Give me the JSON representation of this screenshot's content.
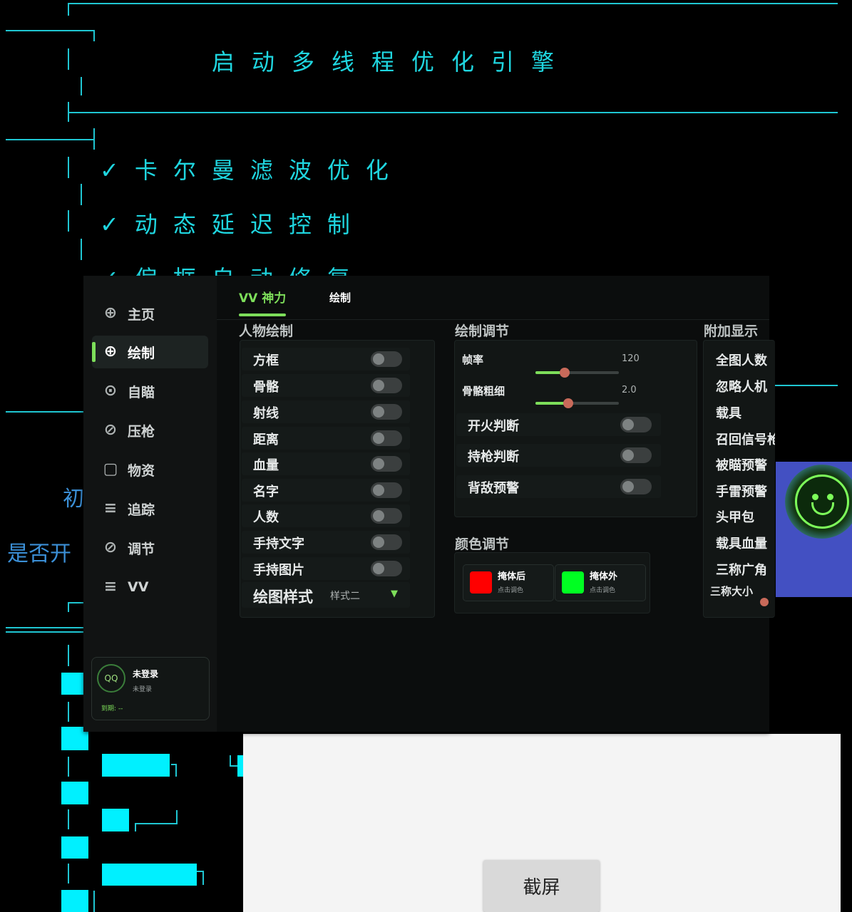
{
  "background": {
    "title": "启动多线程优化引擎",
    "checks": [
      "✓卡尔曼滤波优化",
      "✓动态延迟控制",
      "✓偏框自动修复"
    ],
    "side_text_1": "初",
    "side_text_2": "是否开"
  },
  "colors": {
    "accent": "#7dde5a",
    "cyan": "#1fd6e0",
    "swatch_red": "#ff0000",
    "swatch_green": "#00ff22"
  },
  "menu": {
    "sidebar": [
      {
        "icon": "crosshair-icon",
        "glyph": "⊕",
        "label": "主页"
      },
      {
        "icon": "crosshair-icon",
        "glyph": "⊕",
        "label": "绘制"
      },
      {
        "icon": "target-icon",
        "glyph": "⊙",
        "label": "自瞄"
      },
      {
        "icon": "slash-circle-icon",
        "glyph": "⊘",
        "label": "压枪"
      },
      {
        "icon": "box-icon",
        "glyph": "▢",
        "label": "物资"
      },
      {
        "icon": "menu-icon",
        "glyph": "≡",
        "label": "追踪"
      },
      {
        "icon": "slash-circle-icon",
        "glyph": "⊘",
        "label": "调节"
      },
      {
        "icon": "menu-icon",
        "glyph": "≡",
        "label": "VV"
      }
    ],
    "user": {
      "badge": "QQ",
      "name": "未登录",
      "status": "未登录",
      "expiry": "到期: --"
    },
    "tabs": [
      "VV 神力",
      "绘制"
    ],
    "person_draw": {
      "title": "人物绘制",
      "items": [
        "方框",
        "骨骼",
        "射线",
        "距离",
        "血量",
        "名字",
        "人数",
        "手持文字",
        "手持图片"
      ],
      "style_label": "绘图样式",
      "style_value": "样式二"
    },
    "draw_adjust": {
      "title": "绘制调节",
      "fps_label": "帧率",
      "fps_value": "120",
      "fps_fraction": 0.35,
      "bone_label": "骨骼粗细",
      "bone_value": "2.0",
      "bone_fraction": 0.39,
      "toggles": [
        "开火判断",
        "持枪判断",
        "背敌预警"
      ]
    },
    "color_adjust": {
      "title": "颜色调节",
      "items": [
        {
          "name": "掩体后",
          "hint": "点击调色"
        },
        {
          "name": "掩体外",
          "hint": "点击调色"
        }
      ]
    },
    "extra": {
      "title": "附加显示",
      "items": [
        "全图人数",
        "忽略人机",
        "载具",
        "召回信号枪",
        "被瞄预警",
        "手雷预警",
        "头甲包",
        "载具血量",
        "三称广角"
      ],
      "size_label": "三称大小"
    }
  },
  "screenshot_button": "截屏"
}
